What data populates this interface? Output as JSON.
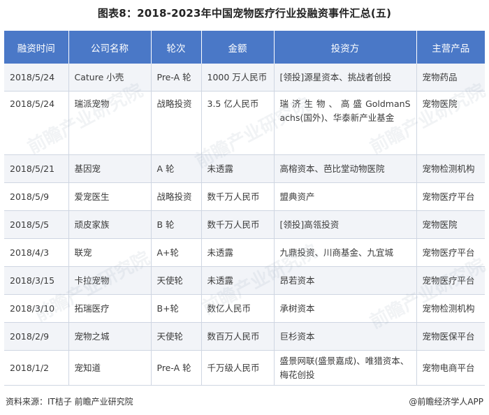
{
  "title": "图表8：2018-2023年中国宠物医疗行业投融资事件汇总(五)",
  "headers": [
    "融资时间",
    "公司名称",
    "轮次",
    "金额",
    "投资方",
    "主营产品"
  ],
  "rows": [
    {
      "date": "2018/5/24",
      "company": "Cature 小壳",
      "round": "Pre-A 轮",
      "amount": "1000 万人民币",
      "investors": "[领投]源星资本、挑战者创投",
      "product": "宠物药品"
    },
    {
      "date": "2018/5/24",
      "company": "瑞派宠物",
      "round": "战略投资",
      "amount": "3.5 亿人民币",
      "investors": "瑞 济 生 物 、 高 盛 GoldmanSachs(国外)、华泰新产业基金",
      "product": "宠物医院"
    },
    {
      "date": "2018/5/21",
      "company": "基因宠",
      "round": "A 轮",
      "amount": "未透露",
      "investors": "高榕资本、芭比堂动物医院",
      "product": "宠物检测机构"
    },
    {
      "date": "2018/5/9",
      "company": "爱宠医生",
      "round": "战略投资",
      "amount": "数千万人民币",
      "investors": "盟典资产",
      "product": "宠物医疗平台"
    },
    {
      "date": "2018/5/5",
      "company": "顽皮家族",
      "round": "B 轮",
      "amount": "数千万人民币",
      "investors": "[领投]高瓴投资",
      "product": "宠物医院"
    },
    {
      "date": "2018/4/3",
      "company": "联宠",
      "round": "A+轮",
      "amount": "未透露",
      "investors": "九鼎投资、川商基金、九宜城",
      "product": "宠物医疗平台"
    },
    {
      "date": "2018/3/15",
      "company": "卡拉宠物",
      "round": "天使轮",
      "amount": "未透露",
      "investors": "昂若资本",
      "product": "宠物医疗平台"
    },
    {
      "date": "2018/3/10",
      "company": "拓瑞医疗",
      "round": "B+轮",
      "amount": "数亿人民币",
      "investors": "承树资本",
      "product": "宠物检测机构"
    },
    {
      "date": "2018/2/9",
      "company": "宠物之城",
      "round": "天使轮",
      "amount": "数百万人民币",
      "investors": "巨杉资本",
      "product": "宠物医保平台"
    },
    {
      "date": "2018/1/2",
      "company": "宠知道",
      "round": "Pre-A 轮",
      "amount": "千万级人民币",
      "investors": "盛景网联(盛景嘉成)、唯猎资本、梅花创投",
      "product": "宠物电商平台"
    }
  ],
  "footer": {
    "source": "资料来源：IT桔子 前瞻产业研究院",
    "brand": "@前瞻经济学人APP"
  },
  "watermark": "前瞻产业研究院",
  "colors": {
    "header_bg": "#4a78c7",
    "odd_row": "#f2f4f8",
    "border": "#cfd6e2"
  }
}
